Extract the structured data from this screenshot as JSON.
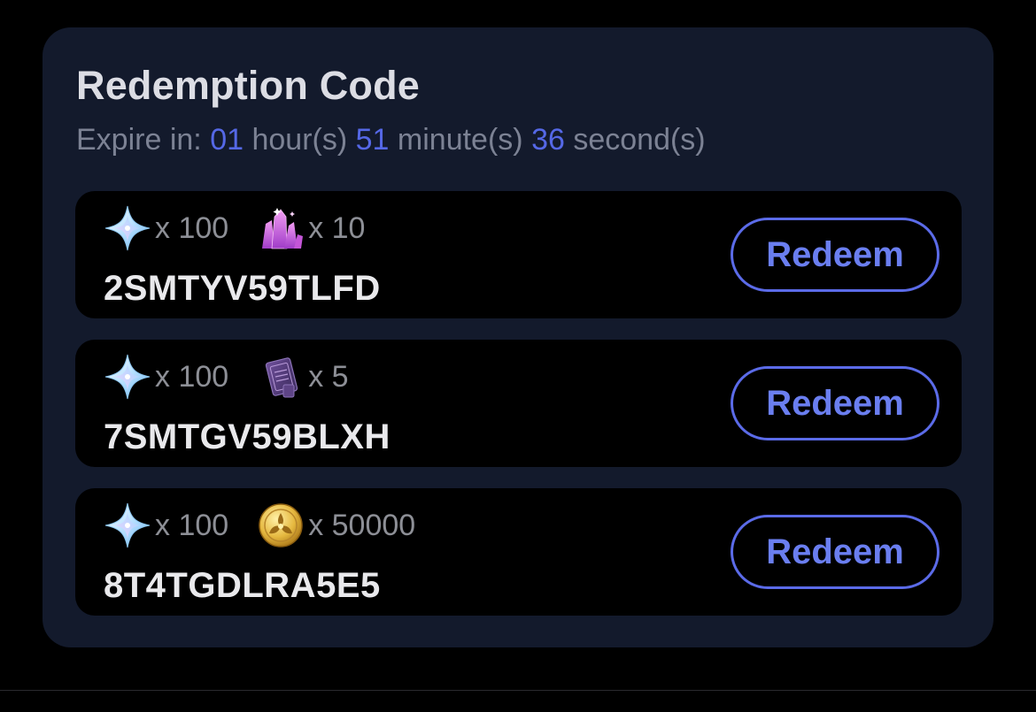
{
  "card": {
    "title": "Redemption Code",
    "expire": {
      "label": "Expire in:",
      "hours": "01",
      "hours_unit": "hour(s)",
      "minutes": "51",
      "minutes_unit": "minute(s)",
      "seconds": "36",
      "seconds_unit": "second(s)"
    }
  },
  "codes": [
    {
      "rewards": [
        {
          "icon": "primogem-icon",
          "qty": "x 100"
        },
        {
          "icon": "crystal-icon",
          "qty": "x 10"
        }
      ],
      "code": "2SMTYV59TLFD",
      "button": "Redeem"
    },
    {
      "rewards": [
        {
          "icon": "primogem-icon",
          "qty": "x 100"
        },
        {
          "icon": "book-icon",
          "qty": "x 5"
        }
      ],
      "code": "7SMTGV59BLXH",
      "button": "Redeem"
    },
    {
      "rewards": [
        {
          "icon": "primogem-icon",
          "qty": "x 100"
        },
        {
          "icon": "coin-icon",
          "qty": "x 50000"
        }
      ],
      "code": "8T4TGDLRA5E5",
      "button": "Redeem"
    }
  ],
  "colors": {
    "background": "#000000",
    "card": "#131a2c",
    "accent": "#5b6be8",
    "timer_number": "#5568e6"
  }
}
